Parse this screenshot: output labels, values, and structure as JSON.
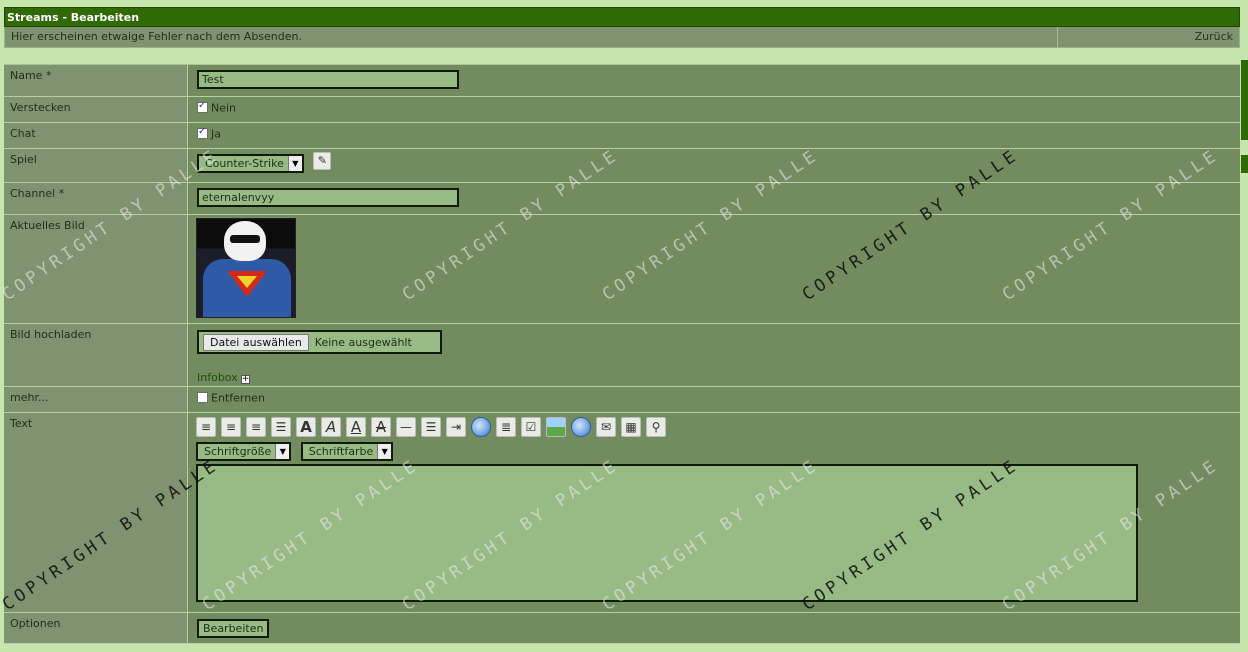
{
  "window": {
    "title": "Streams - Bearbeiten"
  },
  "info": {
    "message": "Hier erscheinen etwaige Fehler nach dem Absenden.",
    "back_label": "Zurück"
  },
  "fields": {
    "name": {
      "label": "Name *",
      "value": "Test"
    },
    "hide": {
      "label": "Verstecken",
      "checked": true,
      "text": "Nein"
    },
    "chat": {
      "label": "Chat",
      "checked": true,
      "text": "Ja"
    },
    "game": {
      "label": "Spiel",
      "selected": "Counter-Strike"
    },
    "channel": {
      "label": "Channel *",
      "value": "eternalenvyy"
    },
    "current_image": {
      "label": "Aktuelles Bild"
    },
    "upload": {
      "label": "Bild hochladen",
      "button": "Datei auswählen",
      "status": "Keine ausgewählt",
      "infobox": "Infobox"
    },
    "more": {
      "label": "mehr...",
      "checked": false,
      "text": "Entfernen"
    },
    "text": {
      "label": "Text",
      "font_size": "Schriftgröße",
      "font_color": "Schriftfarbe",
      "toolbar": [
        "align-left-icon",
        "align-center-icon",
        "align-right-icon",
        "justify-icon",
        "bold-icon",
        "italic-icon",
        "underline-icon",
        "strikethrough-icon",
        "horizontal-rule-icon",
        "list-icon",
        "indent-icon",
        "quote-icon",
        "code-icon",
        "checklist-icon",
        "image-icon",
        "link-icon",
        "email-icon",
        "table-icon",
        "search-icon"
      ]
    },
    "options": {
      "label": "Optionen",
      "submit": "Bearbeiten"
    }
  },
  "watermark": "COPYRIGHT BY PALLE"
}
